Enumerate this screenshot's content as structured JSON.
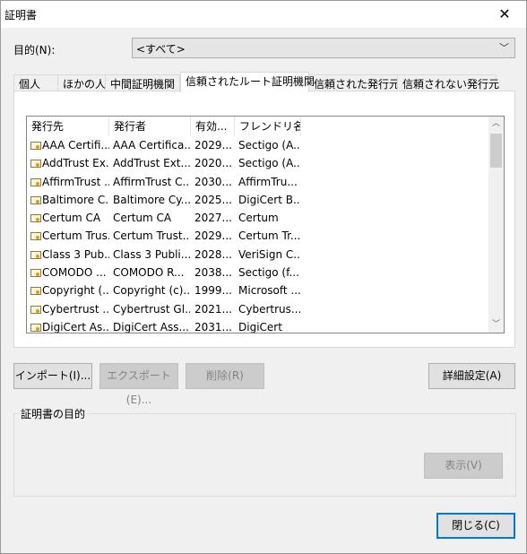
{
  "window": {
    "title": "証明書",
    "close_glyph": "✕"
  },
  "purpose": {
    "label": "目的(N):",
    "selected": "<すべて>",
    "arrow": "﹀"
  },
  "tabs": [
    {
      "label": "個人"
    },
    {
      "label": "ほかの人"
    },
    {
      "label": "中間証明機関"
    },
    {
      "label": "信頼されたルート証明機関"
    },
    {
      "label": "信頼された発行元"
    },
    {
      "label": "信頼されない発行元"
    }
  ],
  "list": {
    "columns": [
      "発行先",
      "発行者",
      "有効...",
      "フレンドリ名"
    ],
    "rows": [
      [
        "AAA Certifi...",
        "AAA Certifica...",
        "2029...",
        "Sectigo (A..."
      ],
      [
        "AddTrust Ex...",
        "AddTrust Ext...",
        "2020...",
        "Sectigo (A..."
      ],
      [
        "AffirmTrust ...",
        "AffirmTrust C...",
        "2030...",
        "AffirmTru..."
      ],
      [
        "Baltimore C...",
        "Baltimore Cy...",
        "2025...",
        "DigiCert B..."
      ],
      [
        "Certum CA",
        "Certum CA",
        "2027...",
        "Certum"
      ],
      [
        "Certum Trus...",
        "Certum Trust...",
        "2029...",
        "Certum Tr..."
      ],
      [
        "Class 3 Pub...",
        "Class 3 Publi...",
        "2028...",
        "VeriSign C..."
      ],
      [
        "COMODO ...",
        "COMODO R...",
        "2038...",
        "Sectigo (f..."
      ],
      [
        "Copyright (...",
        "Copyright (c)...",
        "1999...",
        "Microsoft ..."
      ],
      [
        "Cybertrust ...",
        "Cybertrust Gl...",
        "2021...",
        "Cybertrus..."
      ],
      [
        "DigiCert As...",
        "DigiCert Ass...",
        "2031...",
        "DigiCert"
      ]
    ],
    "scroll_up": "︿",
    "scroll_down": "﹀"
  },
  "buttons": {
    "import": "インポート(I)...",
    "export": "エクスポート(E)...",
    "delete": "削除(R)",
    "advanced": "詳細設定(A)",
    "view": "表示(V)",
    "close": "閉じる(C)"
  },
  "purpose_group": {
    "label": "証明書の目的"
  }
}
